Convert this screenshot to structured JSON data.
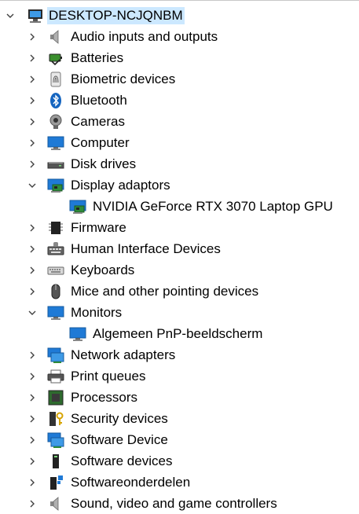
{
  "computer_name": "DESKTOP-NCJQNBM",
  "categories": {
    "audio": "Audio inputs and outputs",
    "batteries": "Batteries",
    "biometric": "Biometric devices",
    "bluetooth": "Bluetooth",
    "cameras": "Cameras",
    "computer": "Computer",
    "disk": "Disk drives",
    "display": "Display adaptors",
    "display_child": "NVIDIA GeForce RTX 3070 Laptop GPU",
    "firmware": "Firmware",
    "hid": "Human Interface Devices",
    "keyboards": "Keyboards",
    "mice": "Mice and other pointing devices",
    "monitors": "Monitors",
    "monitors_child": "Algemeen PnP-beeldscherm",
    "network": "Network adapters",
    "print": "Print queues",
    "processors": "Processors",
    "security": "Security devices",
    "software_device": "Software Device",
    "software_devices": "Software devices",
    "softwareonderdelen": "Softwareonderdelen",
    "sound": "Sound, video and game controllers"
  },
  "icons": {
    "root": "computer-icon",
    "audio": "speaker-icon",
    "batteries": "battery-icon",
    "biometric": "fingerprint-icon",
    "bluetooth": "bluetooth-icon",
    "cameras": "webcam-icon",
    "computer": "monitor-icon",
    "disk": "disk-drive-icon",
    "display": "display-adapter-icon",
    "firmware": "chip-icon",
    "hid": "hid-icon",
    "keyboards": "keyboard-icon",
    "mice": "mouse-icon",
    "monitors": "monitor-icon",
    "network": "network-icon",
    "print": "printer-icon",
    "processors": "processor-icon",
    "security": "security-key-icon",
    "software_device": "software-device-icon",
    "software_devices": "software-devices-icon",
    "softwareonderdelen": "software-component-icon",
    "sound": "speaker-icon"
  },
  "colors": {
    "selection": "#cce8ff",
    "chevron": "#404040",
    "text": "#000000",
    "monitor_blue": "#1f7ad6"
  }
}
